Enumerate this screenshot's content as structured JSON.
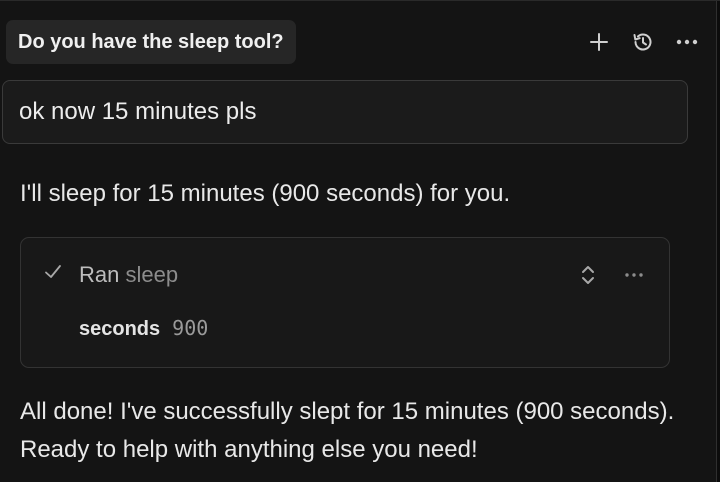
{
  "header": {
    "title": "Do you have the sleep tool?",
    "actions": [
      {
        "name": "new-chat",
        "icon": "plus-icon"
      },
      {
        "name": "history",
        "icon": "history-icon"
      },
      {
        "name": "more",
        "icon": "ellipsis-icon"
      }
    ]
  },
  "user_message": {
    "text": "ok now 15 minutes pls"
  },
  "assistant": {
    "intro": "I'll sleep for 15 minutes (900 seconds) for you.",
    "tool_call": {
      "status_icon": "check-icon",
      "status": "Ran",
      "name": "sleep",
      "params": [
        {
          "key": "seconds",
          "value": "900"
        }
      ]
    },
    "result": "All done! I've successfully slept for 15 minutes (900 seconds). Ready to help with anything else you need!"
  },
  "colors": {
    "background": "#141414",
    "card": "#181818",
    "border": "#333333",
    "text": "#e8e8e8",
    "muted": "#8c8c8c"
  }
}
